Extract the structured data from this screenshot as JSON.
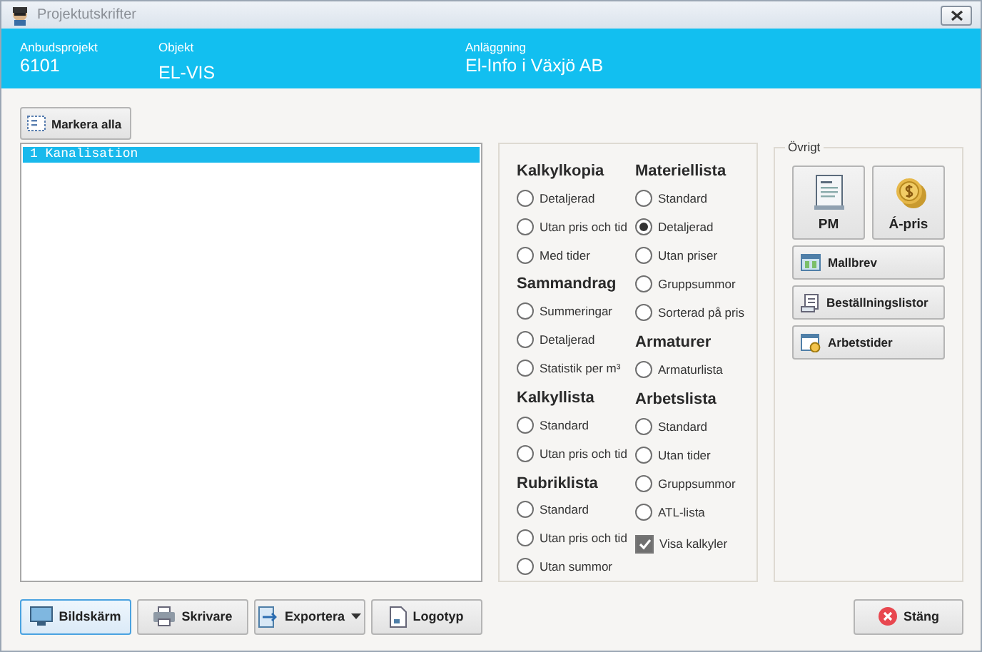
{
  "window": {
    "title": "Projektutskrifter"
  },
  "header": [
    {
      "label": "Anbudsprojekt",
      "value": "6101"
    },
    {
      "label": "Objekt",
      "value": "EL-VIS"
    },
    {
      "label": "Anläggning",
      "value": "El-Info i Växjö AB"
    }
  ],
  "mark_all_button": "Markera alla",
  "list": [
    {
      "number": "1",
      "label": "Kanalisation",
      "selected": true
    }
  ],
  "option_columns": [
    [
      {
        "title": "Kalkylkopia",
        "options": [
          {
            "kind": "radio",
            "label": "Detaljerad",
            "selected": false
          },
          {
            "kind": "radio",
            "label": "Utan pris och tid",
            "selected": false
          },
          {
            "kind": "radio",
            "label": "Med tider",
            "selected": false
          }
        ]
      },
      {
        "title": "Sammandrag",
        "options": [
          {
            "kind": "radio",
            "label": "Summeringar",
            "selected": false
          },
          {
            "kind": "radio",
            "label": "Detaljerad",
            "selected": false
          },
          {
            "kind": "radio",
            "label": "Statistik per m³",
            "selected": false
          }
        ]
      },
      {
        "title": "Kalkyllista",
        "options": [
          {
            "kind": "radio",
            "label": "Standard",
            "selected": false
          },
          {
            "kind": "radio",
            "label": "Utan pris och tid",
            "selected": false
          }
        ]
      },
      {
        "title": "Rubriklista",
        "options": [
          {
            "kind": "radio",
            "label": "Standard",
            "selected": false
          },
          {
            "kind": "radio",
            "label": "Utan pris och tid",
            "selected": false
          },
          {
            "kind": "radio",
            "label": "Utan summor",
            "selected": false
          }
        ]
      }
    ],
    [
      {
        "title": "Materiellista",
        "options": [
          {
            "kind": "radio",
            "label": "Standard",
            "selected": false
          },
          {
            "kind": "radio",
            "label": "Detaljerad",
            "selected": true
          },
          {
            "kind": "radio",
            "label": "Utan priser",
            "selected": false
          },
          {
            "kind": "radio",
            "label": "Gruppsummor",
            "selected": false
          },
          {
            "kind": "radio",
            "label": "Sorterad på pris",
            "selected": false
          }
        ]
      },
      {
        "title": "Armaturer",
        "options": [
          {
            "kind": "radio",
            "label": "Armaturlista",
            "selected": false
          }
        ]
      },
      {
        "title": "Arbetslista",
        "options": [
          {
            "kind": "radio",
            "label": "Standard",
            "selected": false
          },
          {
            "kind": "radio",
            "label": "Utan tider",
            "selected": false
          },
          {
            "kind": "radio",
            "label": "Gruppsummor",
            "selected": false
          },
          {
            "kind": "radio",
            "label": "ATL-lista",
            "selected": false
          },
          {
            "kind": "checkbox",
            "label": "Visa kalkyler",
            "checked": true
          }
        ]
      }
    ]
  ],
  "other": {
    "title": "Övrigt",
    "large_buttons": [
      "PM",
      "Á-pris"
    ],
    "buttons": [
      "Mallbrev",
      "Beställningslistor",
      "Arbetstider"
    ]
  },
  "bottom_buttons": [
    {
      "label": "Bildskärm",
      "focused": true,
      "has_menu": false
    },
    {
      "label": "Skrivare",
      "focused": false,
      "has_menu": false
    },
    {
      "label": "Exportera",
      "focused": false,
      "has_menu": true
    },
    {
      "label": "Logotyp",
      "focused": false,
      "has_menu": false
    }
  ],
  "close_button": "Stäng"
}
